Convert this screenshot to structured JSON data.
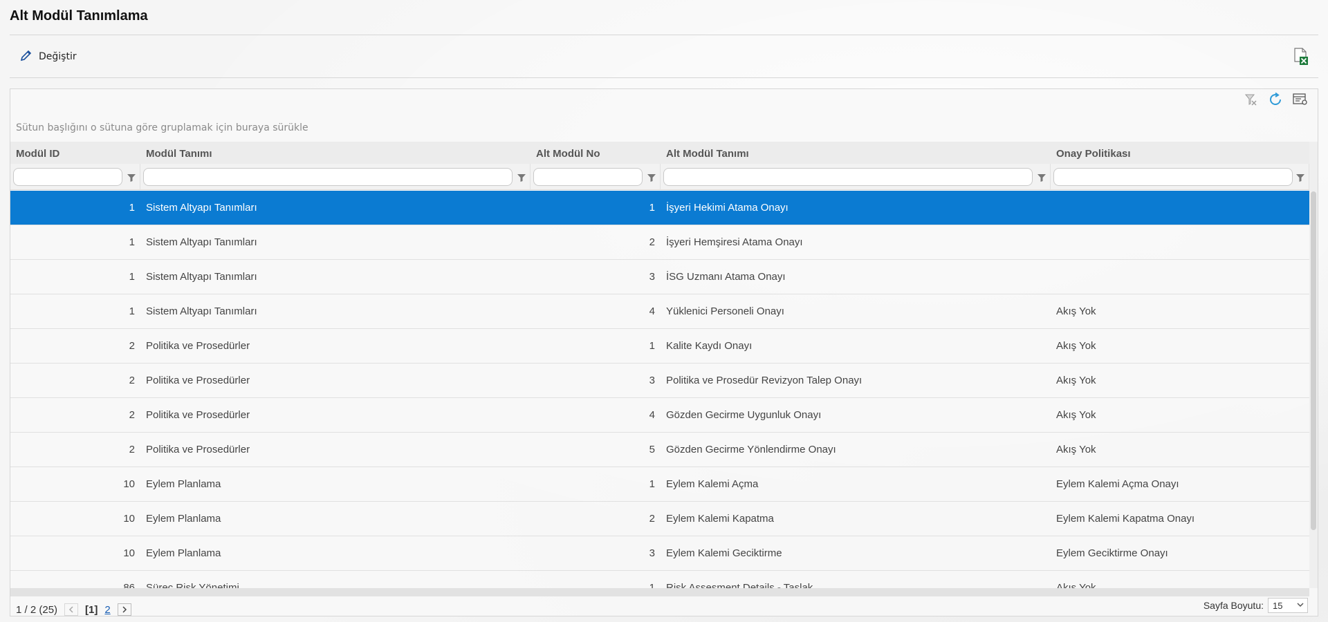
{
  "page": {
    "title": "Alt Modül Tanımlama"
  },
  "toolbar": {
    "edit_label": "Değiştir"
  },
  "grid": {
    "group_hint": "Sütun başlığını o sütuna göre gruplamak için buraya sürükle",
    "columns": [
      "Modül ID",
      "Modül Tanımı",
      "Alt Modül No",
      "Alt Modül Tanımı",
      "Onay Politikası"
    ],
    "rows": [
      {
        "modul_id": "1",
        "modul_tanimi": "Sistem Altyapı Tanımları",
        "alt_no": "1",
        "alt_tanimi": "İşyeri Hekimi Atama Onayı",
        "onay": ""
      },
      {
        "modul_id": "1",
        "modul_tanimi": "Sistem Altyapı Tanımları",
        "alt_no": "2",
        "alt_tanimi": "İşyeri Hemşiresi Atama Onayı",
        "onay": ""
      },
      {
        "modul_id": "1",
        "modul_tanimi": "Sistem Altyapı Tanımları",
        "alt_no": "3",
        "alt_tanimi": "İSG Uzmanı Atama Onayı",
        "onay": ""
      },
      {
        "modul_id": "1",
        "modul_tanimi": "Sistem Altyapı Tanımları",
        "alt_no": "4",
        "alt_tanimi": "Yüklenici Personeli Onayı",
        "onay": "Akış Yok"
      },
      {
        "modul_id": "2",
        "modul_tanimi": "Politika ve Prosedürler",
        "alt_no": "1",
        "alt_tanimi": "Kalite Kaydı Onayı",
        "onay": "Akış Yok"
      },
      {
        "modul_id": "2",
        "modul_tanimi": "Politika ve Prosedürler",
        "alt_no": "3",
        "alt_tanimi": "Politika ve Prosedür Revizyon Talep Onayı",
        "onay": "Akış Yok"
      },
      {
        "modul_id": "2",
        "modul_tanimi": "Politika ve Prosedürler",
        "alt_no": "4",
        "alt_tanimi": "Gözden Gecirme Uygunluk Onayı",
        "onay": "Akış Yok"
      },
      {
        "modul_id": "2",
        "modul_tanimi": "Politika ve Prosedürler",
        "alt_no": "5",
        "alt_tanimi": "Gözden Gecirme Yönlendirme Onayı",
        "onay": "Akış Yok"
      },
      {
        "modul_id": "10",
        "modul_tanimi": "Eylem Planlama",
        "alt_no": "1",
        "alt_tanimi": "Eylem Kalemi Açma",
        "onay": "Eylem Kalemi Açma Onayı"
      },
      {
        "modul_id": "10",
        "modul_tanimi": "Eylem Planlama",
        "alt_no": "2",
        "alt_tanimi": "Eylem Kalemi Kapatma",
        "onay": "Eylem Kalemi Kapatma Onayı"
      },
      {
        "modul_id": "10",
        "modul_tanimi": "Eylem Planlama",
        "alt_no": "3",
        "alt_tanimi": "Eylem Kalemi Geciktirme",
        "onay": "Eylem Geciktirme Onayı"
      },
      {
        "modul_id": "86",
        "modul_tanimi": "Süreç Risk Yönetimi",
        "alt_no": "1",
        "alt_tanimi": "Risk Assesment Details - Taslak",
        "onay": "Akış Yok"
      }
    ],
    "selected_index": 0
  },
  "pager": {
    "info": "1 / 2 (25)",
    "current_page": "[1]",
    "next_page": "2",
    "page_size_label": "Sayfa Boyutu:",
    "page_size": "15"
  },
  "colors": {
    "selected_row": "#0b7bd2",
    "link": "#1a5fb4",
    "refresh_icon": "#2f9bd8",
    "excel_green": "#1e7b3c"
  },
  "icons": [
    "pencil-icon",
    "excel-export-icon",
    "clear-filter-icon",
    "refresh-icon",
    "column-chooser-icon",
    "filter-icon",
    "chevron-left-icon",
    "chevron-right-icon",
    "chevron-down-icon"
  ]
}
